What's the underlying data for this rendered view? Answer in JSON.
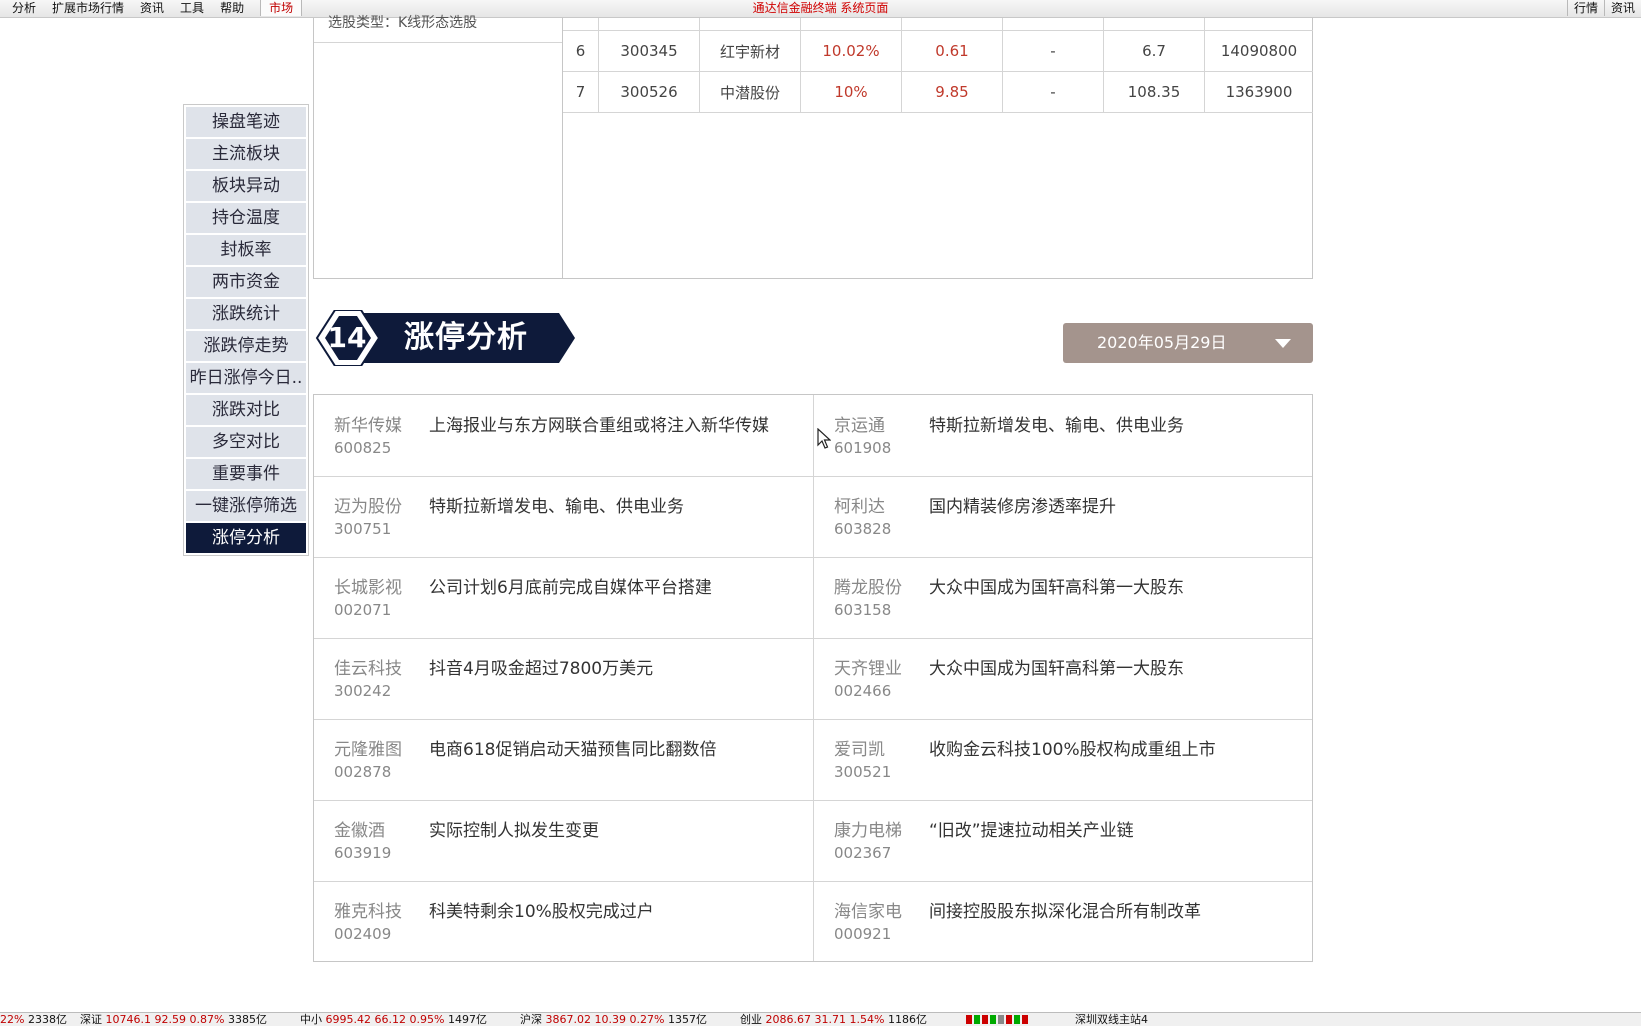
{
  "menubar": {
    "left_items": [
      "分析",
      "扩展市场行情",
      "资讯",
      "工具",
      "帮助"
    ],
    "active_tab": "市场",
    "center_title": "通达信金融终端  系统页面",
    "right_items": [
      "行情",
      "资讯"
    ]
  },
  "sidenav": {
    "items": [
      "操盘笔迹",
      "主流板块",
      "板块异动",
      "持仓温度",
      "封板率",
      "两市资金",
      "涨跌统计",
      "涨跌停走势",
      "昨日涨停今日..",
      "涨跌对比",
      "多空对比",
      "重要事件",
      "一键涨停筛选",
      "涨停分析"
    ],
    "active_index": 13
  },
  "upper_panel": {
    "left_text": "选股类型：K线形态选股",
    "rows": [
      {
        "idx": "6",
        "code": "300345",
        "name": "红宇新材",
        "pct": "10.02%",
        "chg": "0.61",
        "dash": "-",
        "val": "6.7",
        "vol": "14090800"
      },
      {
        "idx": "7",
        "code": "300526",
        "name": "中潜股份",
        "pct": "10%",
        "chg": "9.85",
        "dash": "-",
        "val": "108.35",
        "vol": "1363900"
      }
    ]
  },
  "section": {
    "number": "14",
    "title": "涨停分析"
  },
  "date_select": {
    "value": "2020年05月29日"
  },
  "analysis": {
    "rows": [
      [
        {
          "name": "新华传媒",
          "code": "600825",
          "desc": "上海报业与东方网联合重组或将注入新华传媒"
        },
        {
          "name": "京运通",
          "code": "601908",
          "desc": "特斯拉新增发电、输电、供电业务"
        }
      ],
      [
        {
          "name": "迈为股份",
          "code": "300751",
          "desc": "特斯拉新增发电、输电、供电业务"
        },
        {
          "name": "柯利达",
          "code": "603828",
          "desc": "国内精装修房渗透率提升"
        }
      ],
      [
        {
          "name": "长城影视",
          "code": "002071",
          "desc": "公司计划6月底前完成自媒体平台搭建"
        },
        {
          "name": "腾龙股份",
          "code": "603158",
          "desc": "大众中国成为国轩高科第一大股东"
        }
      ],
      [
        {
          "name": "佳云科技",
          "code": "300242",
          "desc": "抖音4月吸金超过7800万美元"
        },
        {
          "name": "天齐锂业",
          "code": "002466",
          "desc": "大众中国成为国轩高科第一大股东"
        }
      ],
      [
        {
          "name": "元隆雅图",
          "code": "002878",
          "desc": "电商618促销启动天猫预售同比翻数倍"
        },
        {
          "name": "爱司凯",
          "code": "300521",
          "desc": "收购金云科技100%股权构成重组上市"
        }
      ],
      [
        {
          "name": "金徽酒",
          "code": "603919",
          "desc": "实际控制人拟发生变更"
        },
        {
          "name": "康力电梯",
          "code": "002367",
          "desc": "“旧改”提速拉动相关产业链"
        }
      ],
      [
        {
          "name": "雅克科技",
          "code": "002409",
          "desc": "科美特剩余10%股权完成过户"
        },
        {
          "name": "海信家电",
          "code": "000921",
          "desc": "间接控股股东拟深化混合所有制改革"
        }
      ]
    ]
  },
  "statusbar": {
    "s0a": "22%",
    "s0b": "2338亿",
    "s1": "深证",
    "s1a": "10746.1",
    "s1b": "92.59",
    "s1c": "0.87%",
    "s1d": "3385亿",
    "s2": "中小",
    "s2a": "6995.42",
    "s2b": "66.12",
    "s2c": "0.95%",
    "s2d": "1497亿",
    "s3": "沪深",
    "s3a": "3867.02",
    "s3b": "10.39",
    "s3c": "0.27%",
    "s3d": "1357亿",
    "s4": "创业",
    "s4a": "2086.67",
    "s4b": "31.71",
    "s4c": "1.54%",
    "s4d": "1186亿",
    "s5": "深圳双线主站4"
  },
  "colors": {
    "nav_active": "#0e1a3a",
    "date_bg": "#a4948d",
    "up_red": "#c0392b"
  }
}
